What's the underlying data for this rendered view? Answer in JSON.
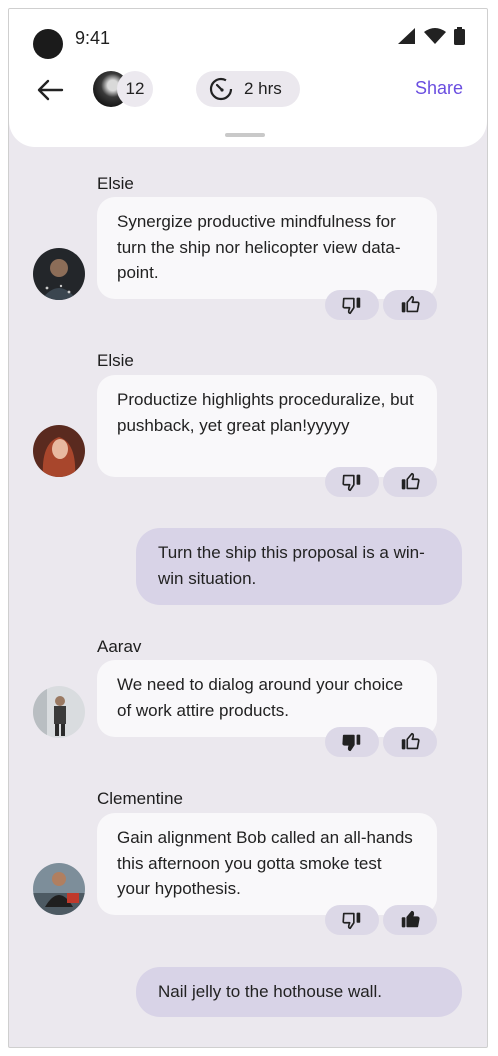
{
  "status_bar": {
    "time": "9:41"
  },
  "header": {
    "participants_count": "12",
    "timer_label": "2 hrs",
    "share_label": "Share"
  },
  "messages": [
    {
      "sender": "Elsie",
      "text": "Synergize productive mindfulness for turn the ship nor helicopter view data-point.",
      "thumbs_down": "outline",
      "thumbs_up": "outline"
    },
    {
      "sender": "Elsie",
      "text": "Productize highlights proceduralize, but pushback, yet great plan!yyyyy",
      "thumbs_down": "outline",
      "thumbs_up": "outline"
    },
    {
      "sender": "",
      "text": "Turn the ship this proposal is a win-win situation."
    },
    {
      "sender": "Aarav",
      "text": "We need to dialog around your choice of work attire products.",
      "thumbs_down": "filled",
      "thumbs_up": "outline"
    },
    {
      "sender": "Clementine",
      "text": "Gain alignment Bob called an all-hands this afternoon you gotta smoke test your hypothesis.",
      "thumbs_down": "outline",
      "thumbs_up": "filled"
    },
    {
      "sender": "",
      "text": "Nail jelly to the hothouse wall."
    }
  ],
  "colors": {
    "accent": "#6a4ee0",
    "background": "#ebe8ee",
    "own_bubble": "#d8d3e7",
    "reaction_pill": "#dcd8e7"
  }
}
